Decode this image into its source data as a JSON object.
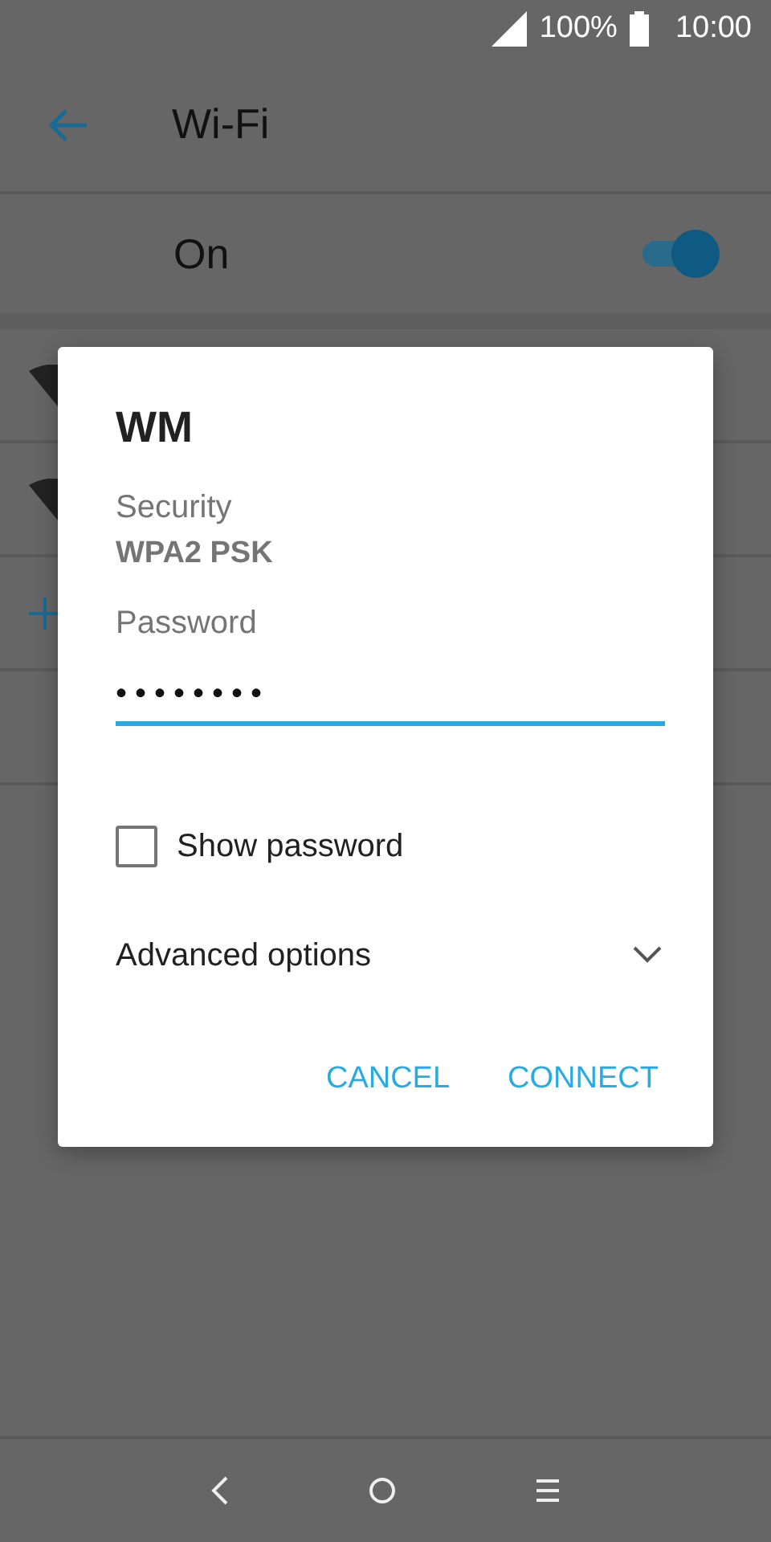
{
  "status_bar": {
    "battery": "100%",
    "time": "10:00"
  },
  "app_bar": {
    "title": "Wi-Fi"
  },
  "wifi_toggle": {
    "label": "On",
    "on": true
  },
  "hidden_rows": [
    {
      "kind": "network"
    },
    {
      "kind": "network"
    },
    {
      "kind": "add"
    },
    {
      "kind": "blank"
    }
  ],
  "dialog": {
    "title": "WM",
    "security_label": "Security",
    "security_value": "WPA2 PSK",
    "password_label": "Password",
    "password_value": "••••••••",
    "show_password": {
      "label": "Show password",
      "checked": false
    },
    "advanced": {
      "label": "Advanced options",
      "expanded": false
    },
    "buttons": [
      "CANCEL",
      "CONNECT"
    ]
  }
}
